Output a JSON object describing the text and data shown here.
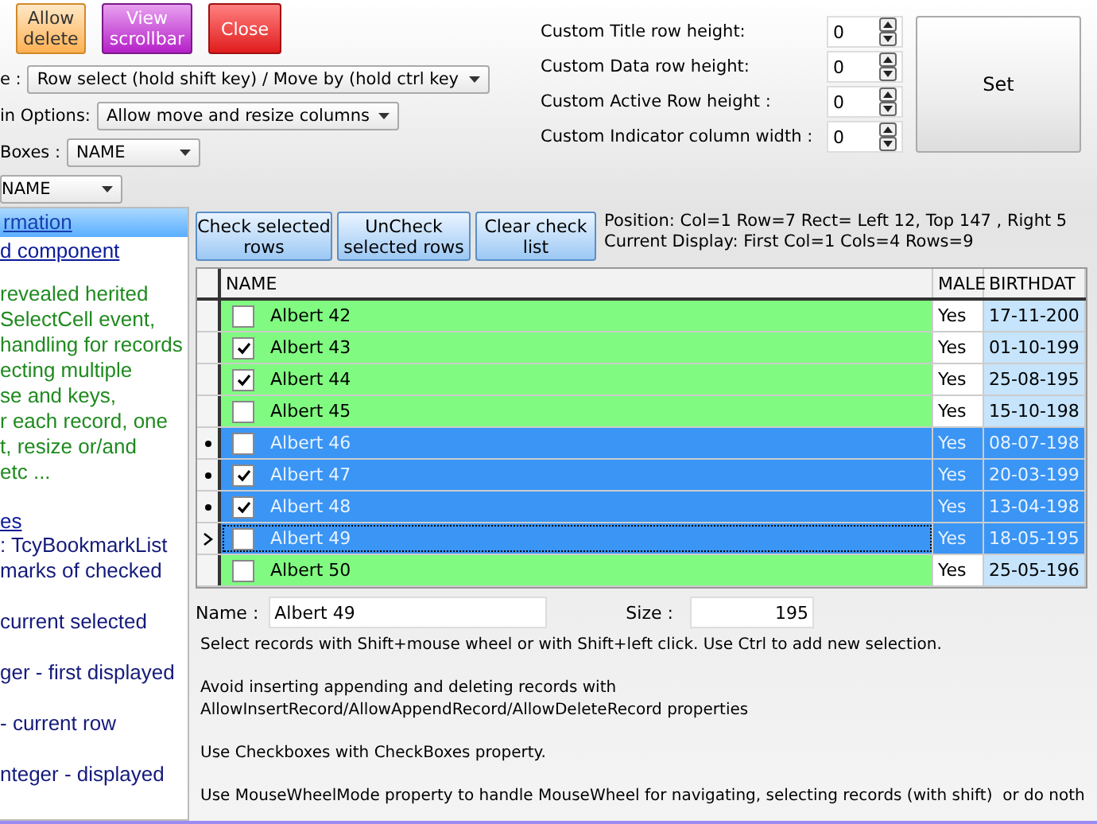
{
  "toolbar": {
    "buttons": [
      {
        "label": "Allow delete",
        "kind": "orange"
      },
      {
        "label": "View scrollbar",
        "kind": "purple"
      },
      {
        "label": "Close",
        "kind": "red"
      }
    ]
  },
  "options": [
    {
      "label": "e :",
      "value": "Row select (hold shift key) / Move by (hold ctrl key"
    },
    {
      "label": "in Options:",
      "value": "Allow move and resize columns"
    },
    {
      "label": "Boxes :",
      "value": "NAME"
    },
    {
      "value": "NAME"
    }
  ],
  "custom_fields": [
    {
      "label": "Custom Title row height:",
      "value": "0"
    },
    {
      "label": "Custom Data row height:",
      "value": "0"
    },
    {
      "label": "Custom Active Row height :",
      "value": "0"
    },
    {
      "label": "Custom Indicator column width :",
      "value": "0"
    }
  ],
  "set_button": "Set",
  "info_panel": {
    "heading": "rmation",
    "link": "d component",
    "description_lines": [
      "revealed herited",
      "SelectCell event,",
      "handling for records",
      "ecting multiple",
      "se and keys,",
      "r each record, one",
      "t, resize or/and",
      "etc ..."
    ],
    "properties_link": "es",
    "property_paragraphs": [
      [
        ": TcyBookmarkList",
        "marks of checked"
      ],
      [
        "current selected"
      ],
      [
        "ger - first displayed"
      ],
      [
        "- current row"
      ],
      [
        "nteger - displayed"
      ]
    ]
  },
  "grid_buttons": [
    "Check selected rows",
    "UnCheck selected rows",
    "Clear check list"
  ],
  "position_lines": [
    "Position:  Col=1     Row=7     Rect= Left 12, Top 147 , Right 5",
    "Current Display: First Col=1     Cols=4     Rows=9"
  ],
  "table": {
    "columns": [
      "NAME",
      "MALE",
      "BIRTHDAT"
    ],
    "rows": [
      {
        "current": false,
        "checked": false,
        "selected": false,
        "name": "Albert 42",
        "male": "Yes",
        "birthdate": "17-11-200"
      },
      {
        "current": false,
        "checked": true,
        "selected": false,
        "name": "Albert 43",
        "male": "Yes",
        "birthdate": "01-10-199"
      },
      {
        "current": false,
        "checked": true,
        "selected": false,
        "name": "Albert 44",
        "male": "Yes",
        "birthdate": "25-08-195"
      },
      {
        "current": false,
        "checked": false,
        "selected": false,
        "name": "Albert 45",
        "male": "Yes",
        "birthdate": "15-10-198"
      },
      {
        "current": false,
        "checked": false,
        "selected": true,
        "name": "Albert 46",
        "male": "Yes",
        "birthdate": "08-07-198"
      },
      {
        "current": false,
        "checked": true,
        "selected": true,
        "name": "Albert 47",
        "male": "Yes",
        "birthdate": "20-03-199"
      },
      {
        "current": false,
        "checked": true,
        "selected": true,
        "name": "Albert 48",
        "male": "Yes",
        "birthdate": "13-04-198"
      },
      {
        "current": true,
        "checked": false,
        "selected": true,
        "name": "Albert 49",
        "male": "Yes",
        "birthdate": "18-05-195"
      },
      {
        "current": false,
        "checked": false,
        "selected": false,
        "name": "Albert 50",
        "male": "Yes",
        "birthdate": "25-05-196"
      }
    ]
  },
  "name_field": {
    "label": "Name :",
    "value": "Albert 49"
  },
  "size_field": {
    "label": "Size :",
    "value": "195"
  },
  "notes": [
    "Select records with Shift+mouse wheel or with Shift+left click. Use Ctrl to add new selection.",
    "Avoid inserting appending and deleting records with\nAllowInsertRecord/AllowAppendRecord/AllowDeleteRecord properties",
    "Use Checkboxes with CheckBoxes property.",
    "Use MouseWheelMode property to handle MouseWheel for navigating, selecting records (with shift)  or do noth"
  ]
}
